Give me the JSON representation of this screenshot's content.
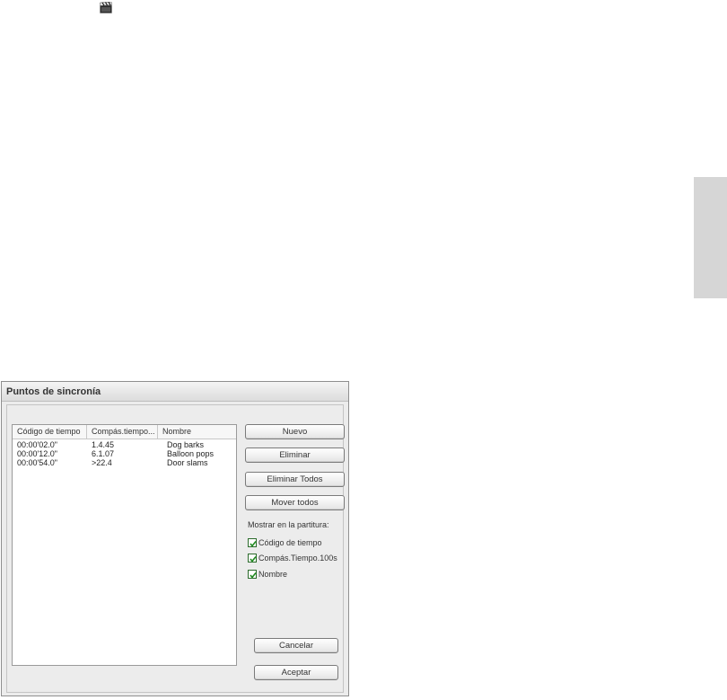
{
  "dialog": {
    "title": "Puntos de sincronía",
    "list": {
      "headers": [
        "Código de tiempo",
        "Compás.tiempo...",
        "Nombre"
      ],
      "rows": [
        [
          "00:00'02.0\"",
          "1.4.45",
          "Dog barks"
        ],
        [
          "00:00'12.0\"",
          "6.1.07",
          "Balloon pops"
        ],
        [
          "00:00'54.0\"",
          ">22.4",
          "Door slams"
        ]
      ]
    },
    "buttons": {
      "new": "Nuevo",
      "delete": "Eliminar",
      "delete_all": "Eliminar Todos",
      "move_all": "Mover todos",
      "cancel": "Cancelar",
      "accept": "Aceptar"
    },
    "show_in_score_label": "Mostrar en la partitura:",
    "checkboxes": [
      {
        "label": "Código de tiempo",
        "checked": true
      },
      {
        "label": "Compás.Tiempo.100s",
        "checked": true
      },
      {
        "label": "Nombre",
        "checked": true
      }
    ]
  },
  "icons": {
    "top_icon": "clapperboard-icon"
  }
}
